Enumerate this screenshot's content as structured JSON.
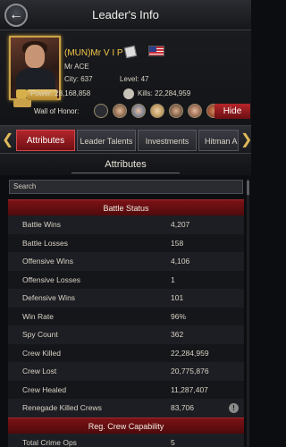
{
  "header": {
    "title": "Leader's Info",
    "back_icon": "arrow-left-icon"
  },
  "profile": {
    "name": "(MUN)Mr V I P",
    "alliance": "Mr ACE",
    "city": "City: 637",
    "level": "Level: 47",
    "power": "Power: 28,168,858",
    "kills": "Kills: 22,284,959",
    "wall_of_honor_label": "Wall of Honor:",
    "hide_label": "Hide"
  },
  "tabs": [
    {
      "label": "Attributes",
      "active": true
    },
    {
      "label": "Leader Talents",
      "active": false
    },
    {
      "label": "Investments",
      "active": false
    },
    {
      "label": "Hitman Ap",
      "active": false
    }
  ],
  "section": {
    "title": "Attributes"
  },
  "search": {
    "placeholder": "Search"
  },
  "table": {
    "group1": "Battle Status",
    "rows": [
      {
        "label": "Battle Wins",
        "value": "4,207"
      },
      {
        "label": "Battle Losses",
        "value": "158"
      },
      {
        "label": "Offensive Wins",
        "value": "4,106"
      },
      {
        "label": "Offensive Losses",
        "value": "1"
      },
      {
        "label": "Defensive Wins",
        "value": "101"
      },
      {
        "label": "Win Rate",
        "value": "96%"
      },
      {
        "label": "Spy Count",
        "value": "362"
      },
      {
        "label": "Crew Killed",
        "value": "22,284,959"
      },
      {
        "label": "Crew Lost",
        "value": "20,775,876"
      },
      {
        "label": "Crew Healed",
        "value": "11,287,407"
      },
      {
        "label": "Renegade Killed Crews",
        "value": "83,706"
      }
    ],
    "group2": "Reg. Crew Capability",
    "rows2": [
      {
        "label": "Total Crime Ops",
        "value": "5"
      }
    ]
  },
  "colors": {
    "accent_red": "#b2262b",
    "gold": "#f4c84a"
  }
}
